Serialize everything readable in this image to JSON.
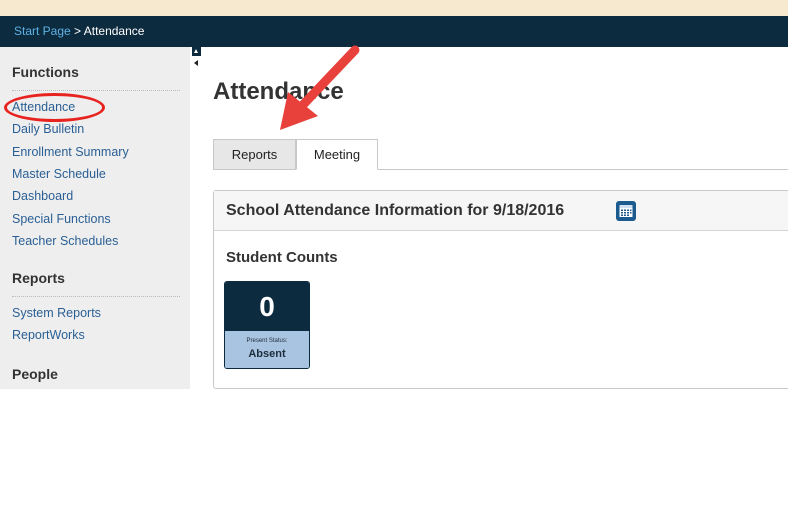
{
  "breadcrumb": {
    "start_label": "Start Page",
    "separator": ">",
    "current_label": "Attendance"
  },
  "sidebar": {
    "functions_heading": "Functions",
    "functions_items": [
      {
        "label": "Attendance"
      },
      {
        "label": "Daily Bulletin"
      },
      {
        "label": "Enrollment Summary"
      },
      {
        "label": "Master Schedule"
      },
      {
        "label": "Dashboard"
      },
      {
        "label": "Special Functions"
      },
      {
        "label": "Teacher Schedules"
      }
    ],
    "reports_heading": "Reports",
    "reports_items": [
      {
        "label": "System Reports"
      },
      {
        "label": "ReportWorks"
      }
    ],
    "people_heading": "People"
  },
  "main": {
    "title": "Attendance",
    "tabs": [
      {
        "label": "Reports",
        "active": false
      },
      {
        "label": "Meeting",
        "active": true
      }
    ],
    "panel": {
      "title": "School Attendance Information for 9/18/2016",
      "calendar_icon": "calendar-icon",
      "counts_title": "Student Counts",
      "tile": {
        "value": "0",
        "status_prefix": "Present Status:",
        "status": "Absent"
      }
    }
  },
  "annotation": {
    "highlight_color": "#e8231f",
    "arrow_color": "#e8413b"
  },
  "colors": {
    "header_bg": "#0d2b3e",
    "top_strip": "#f7e8d0",
    "link": "#2a5f95",
    "breadcrumb_link": "#5fb2e6",
    "tile_top": "#0d2b3e",
    "tile_bottom": "#a9c4e0"
  }
}
